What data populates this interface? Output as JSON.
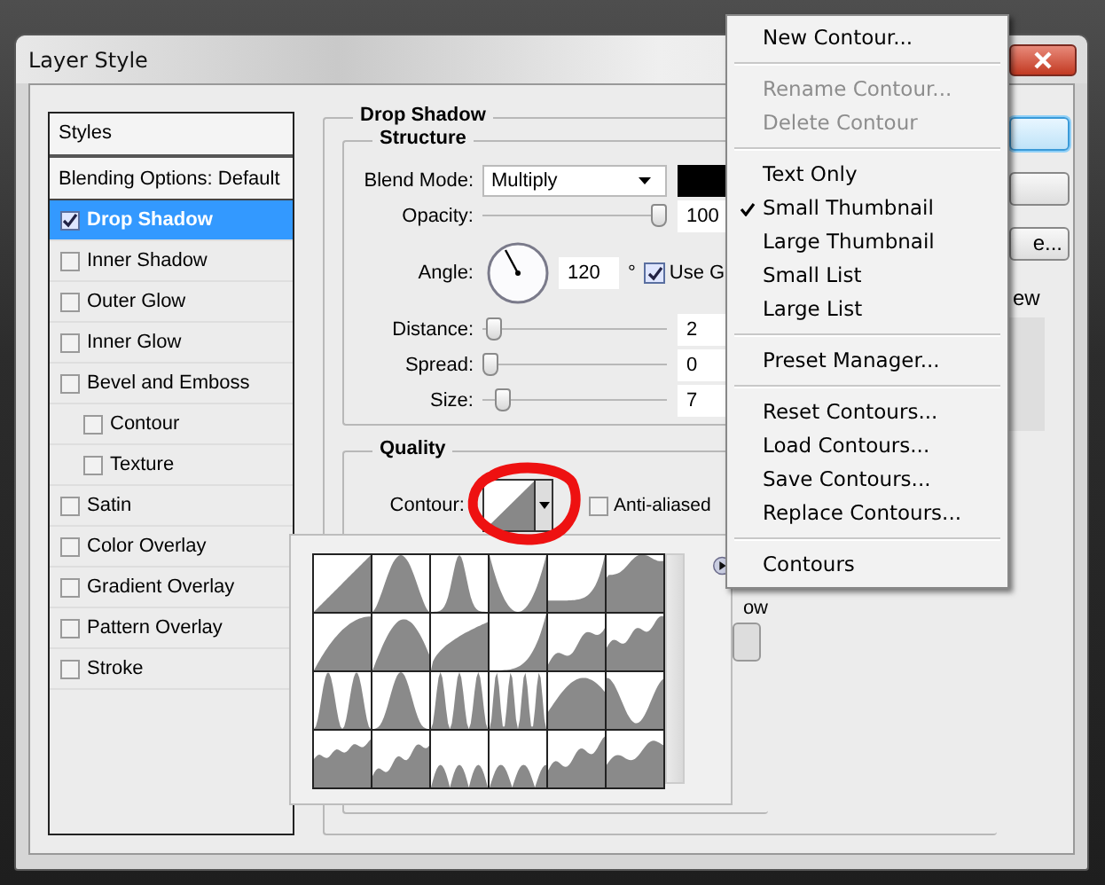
{
  "window": {
    "title": "Layer Style"
  },
  "styles": {
    "header": "Styles",
    "items": [
      {
        "label": "Blending Options: Default",
        "kind": "plain",
        "selected": false
      },
      {
        "label": "Drop Shadow",
        "kind": "check",
        "checked": true,
        "selected": true
      },
      {
        "label": "Inner Shadow",
        "kind": "check",
        "checked": false,
        "selected": false
      },
      {
        "label": "Outer Glow",
        "kind": "check",
        "checked": false,
        "selected": false
      },
      {
        "label": "Inner Glow",
        "kind": "check",
        "checked": false,
        "selected": false
      },
      {
        "label": "Bevel and Emboss",
        "kind": "check",
        "checked": false,
        "selected": false,
        "children": [
          {
            "label": "Contour",
            "kind": "check",
            "checked": false,
            "selected": false
          },
          {
            "label": "Texture",
            "kind": "check",
            "checked": false,
            "selected": false
          }
        ]
      },
      {
        "label": "Satin",
        "kind": "check",
        "checked": false,
        "selected": false
      },
      {
        "label": "Color Overlay",
        "kind": "check",
        "checked": false,
        "selected": false
      },
      {
        "label": "Gradient Overlay",
        "kind": "check",
        "checked": false,
        "selected": false
      },
      {
        "label": "Pattern Overlay",
        "kind": "check",
        "checked": false,
        "selected": false
      },
      {
        "label": "Stroke",
        "kind": "check",
        "checked": false,
        "selected": false
      }
    ]
  },
  "drop_shadow": {
    "title": "Drop Shadow",
    "structure": {
      "title": "Structure",
      "blend_mode": {
        "label": "Blend Mode:",
        "value": "Multiply"
      },
      "opacity": {
        "label": "Opacity:",
        "level": 1.0,
        "value": "100"
      },
      "angle": {
        "label": "Angle:",
        "value": "120",
        "unit": "°",
        "use_global": {
          "label": "Use G",
          "checked": true
        }
      },
      "sliders": [
        {
          "label": "Distance:",
          "level": 0.02,
          "value": "2"
        },
        {
          "label": "Spread:",
          "level": 0.0,
          "value": "0"
        },
        {
          "label": "Size:",
          "level": 0.07,
          "value": "7"
        }
      ]
    },
    "quality": {
      "title": "Quality",
      "contour_label": "Contour:",
      "anti_aliased": {
        "label": "Anti-aliased",
        "checked": false
      },
      "partial_label": "ow"
    }
  },
  "side": {
    "buttons": [
      {
        "label": "e..."
      }
    ],
    "preview_label": "ew"
  },
  "menu": [
    {
      "kind": "item",
      "label": "New Contour...",
      "disabled": false,
      "checked": false
    },
    {
      "kind": "separator"
    },
    {
      "kind": "item",
      "label": "Rename Contour...",
      "disabled": true,
      "checked": false
    },
    {
      "kind": "item",
      "label": "Delete Contour",
      "disabled": true,
      "checked": false
    },
    {
      "kind": "separator"
    },
    {
      "kind": "item",
      "label": "Text Only",
      "disabled": false,
      "checked": false
    },
    {
      "kind": "item",
      "label": "Small Thumbnail",
      "disabled": false,
      "checked": true
    },
    {
      "kind": "item",
      "label": "Large Thumbnail",
      "disabled": false,
      "checked": false
    },
    {
      "kind": "item",
      "label": "Small List",
      "disabled": false,
      "checked": false
    },
    {
      "kind": "item",
      "label": "Large List",
      "disabled": false,
      "checked": false
    },
    {
      "kind": "separator"
    },
    {
      "kind": "item",
      "label": "Preset Manager...",
      "disabled": false,
      "checked": false
    },
    {
      "kind": "separator"
    },
    {
      "kind": "item",
      "label": "Reset Contours...",
      "disabled": false,
      "checked": false
    },
    {
      "kind": "item",
      "label": "Load Contours...",
      "disabled": false,
      "checked": false
    },
    {
      "kind": "item",
      "label": "Save Contours...",
      "disabled": false,
      "checked": false
    },
    {
      "kind": "item",
      "label": "Replace Contours...",
      "disabled": false,
      "checked": false
    },
    {
      "kind": "separator"
    },
    {
      "kind": "item",
      "label": "Contours",
      "disabled": false,
      "checked": false
    }
  ]
}
